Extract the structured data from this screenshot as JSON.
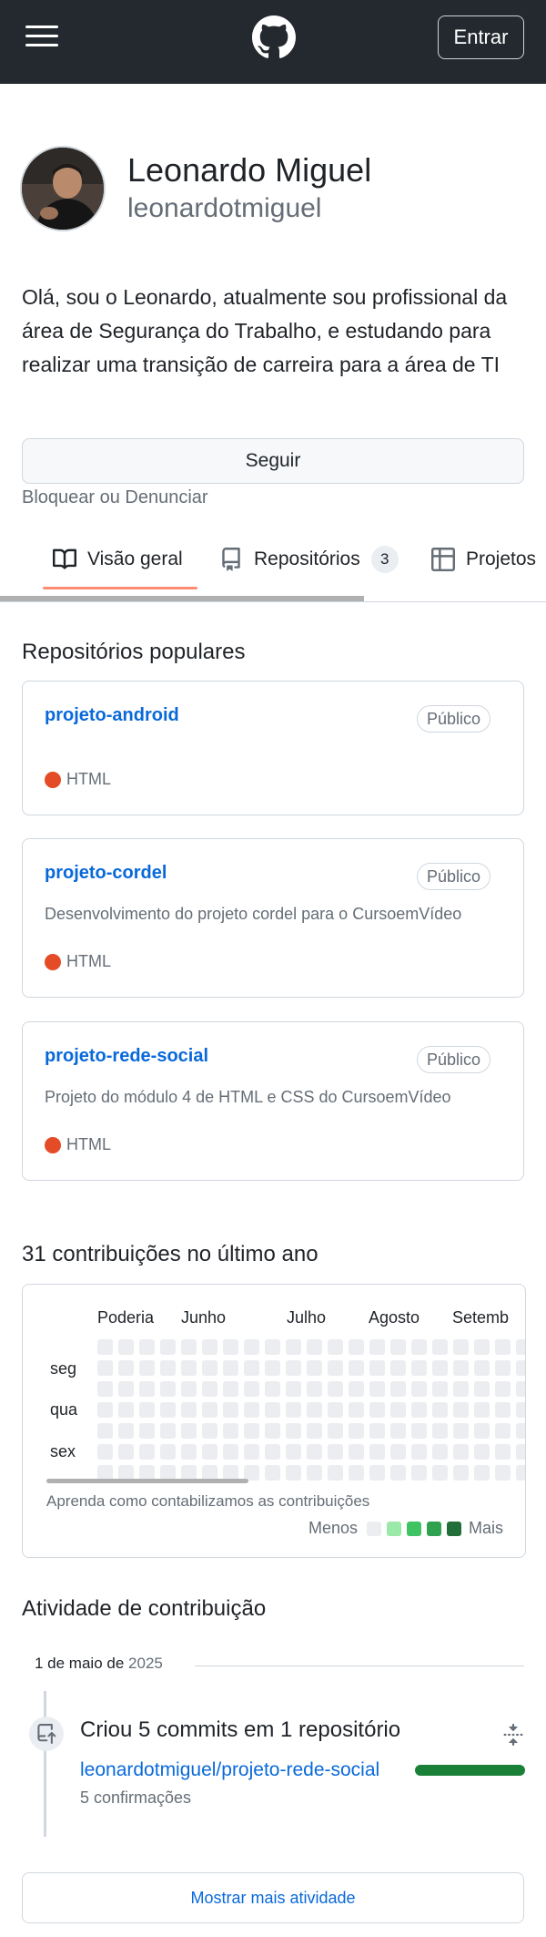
{
  "header": {
    "menu_icon": "hamburger-icon",
    "logo_icon": "github-logo-icon",
    "signin_label": "Entrar",
    "background": "#24292f"
  },
  "profile": {
    "name": "Leonardo Miguel",
    "login": "leonardotmiguel",
    "bio": "Olá, sou o Leonardo, atualmente sou profissional da área de Segurança do Trabalho, e estudando para realizar uma transição de carreira para a área de TI",
    "follow_label": "Seguir",
    "block_label": "Bloquear ou Denunciar"
  },
  "tabs": [
    {
      "label": "Visão geral",
      "icon": "book-icon",
      "selected": true
    },
    {
      "label": "Repositórios",
      "icon": "repo-icon",
      "counter": "3"
    },
    {
      "label": "Projetos",
      "icon": "table-icon"
    }
  ],
  "popular": {
    "title": "Repositórios populares",
    "repos": [
      {
        "name": "projeto-android",
        "visibility": "Público",
        "description": "",
        "language": "HTML",
        "language_color": "#e34c26"
      },
      {
        "name": "projeto-cordel",
        "visibility": "Público",
        "description": "Desenvolvimento do projeto cordel para o CursoemVídeo",
        "language": "HTML",
        "language_color": "#e34c26"
      },
      {
        "name": "projeto-rede-social",
        "visibility": "Público",
        "description": "Projeto do módulo 4 de HTML e CSS do CursoemVídeo",
        "language": "HTML",
        "language_color": "#e34c26"
      }
    ]
  },
  "contributions": {
    "title": "31 contribuições no último ano",
    "months": [
      "Poderia",
      "Junho",
      "Julho",
      "Agosto",
      "Setemb"
    ],
    "days": [
      "seg",
      "qua",
      "sex"
    ],
    "learn_text": "Aprenda como contabilizamos as contribuições",
    "legend_less": "Menos",
    "legend_more": "Mais",
    "legend_colors": [
      "#ebedf0",
      "#9be9a8",
      "#40c463",
      "#30a14e",
      "#216e39"
    ]
  },
  "activity": {
    "title": "Atividade de contribuição",
    "date": "1 de maio de",
    "year": "2025",
    "commit_title": "Criou 5 commits em 1 repositório",
    "repo": "leonardotmiguel/projeto-rede-social",
    "count": "5 confirmações",
    "bar_color": "#1a7f37",
    "show_more": "Mostrar mais atividade"
  }
}
